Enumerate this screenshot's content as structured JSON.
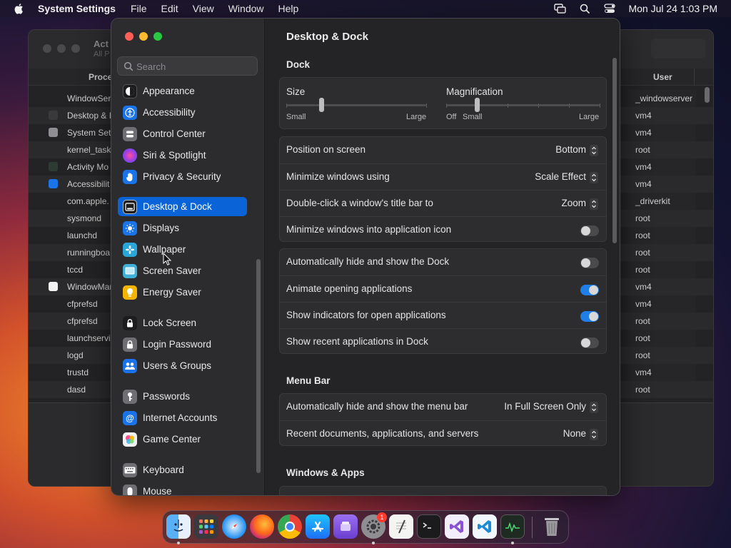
{
  "menubar": {
    "app_name": "System Settings",
    "items": [
      "File",
      "Edit",
      "View",
      "Window",
      "Help"
    ],
    "clock": "Mon Jul 24  1:03 PM"
  },
  "activity_monitor": {
    "title": "Act",
    "subtitle": "All P",
    "col_process": "Proce",
    "col_user": "User",
    "rows": [
      {
        "name": "WindowSer",
        "user": "_windowserver"
      },
      {
        "name": "Desktop & I",
        "user": "vm4"
      },
      {
        "name": "System Set",
        "user": "vm4"
      },
      {
        "name": "kernel_task",
        "user": "root"
      },
      {
        "name": "Activity Mo",
        "user": "vm4"
      },
      {
        "name": "Accessibilit",
        "user": "vm4"
      },
      {
        "name": "com.apple.",
        "user": "_driverkit"
      },
      {
        "name": "sysmond",
        "user": "root"
      },
      {
        "name": "launchd",
        "user": "root"
      },
      {
        "name": "runningboa",
        "user": "root"
      },
      {
        "name": "tccd",
        "user": "root"
      },
      {
        "name": "WindowMar",
        "user": "vm4"
      },
      {
        "name": "cfprefsd",
        "user": "vm4"
      },
      {
        "name": "cfprefsd",
        "user": "root"
      },
      {
        "name": "launchservi",
        "user": "root"
      },
      {
        "name": "logd",
        "user": "root"
      },
      {
        "name": "trustd",
        "user": "vm4"
      },
      {
        "name": "dasd",
        "user": "root"
      }
    ]
  },
  "settings": {
    "search_placeholder": "Search",
    "sidebar": [
      {
        "label": "Appearance",
        "icon": "appearance-icon",
        "color": "#1c1c1e"
      },
      {
        "label": "Accessibility",
        "icon": "accessibility-icon",
        "color": "#1a73e8"
      },
      {
        "label": "Control Center",
        "icon": "control-center-icon",
        "color": "#6e6e73"
      },
      {
        "label": "Siri & Spotlight",
        "icon": "siri-icon",
        "color": "#b03ad6"
      },
      {
        "label": "Privacy & Security",
        "icon": "privacy-hand-icon",
        "color": "#1a73e8"
      },
      {
        "label": "Desktop & Dock",
        "icon": "desktop-dock-icon",
        "color": "#1c1c1e"
      },
      {
        "label": "Displays",
        "icon": "displays-icon",
        "color": "#1a73e8"
      },
      {
        "label": "Wallpaper",
        "icon": "wallpaper-icon",
        "color": "#2aa7d6"
      },
      {
        "label": "Screen Saver",
        "icon": "screen-saver-icon",
        "color": "#3fb0d8"
      },
      {
        "label": "Energy Saver",
        "icon": "energy-saver-icon",
        "color": "#f5b400"
      },
      {
        "label": "Lock Screen",
        "icon": "lock-screen-icon",
        "color": "#1c1c1e"
      },
      {
        "label": "Login Password",
        "icon": "login-password-icon",
        "color": "#6e6e73"
      },
      {
        "label": "Users & Groups",
        "icon": "users-groups-icon",
        "color": "#1a73e8"
      },
      {
        "label": "Passwords",
        "icon": "passwords-key-icon",
        "color": "#6e6e73"
      },
      {
        "label": "Internet Accounts",
        "icon": "internet-accounts-icon",
        "color": "#1a73e8"
      },
      {
        "label": "Game Center",
        "icon": "game-center-icon",
        "color": "#e8e8e8"
      },
      {
        "label": "Keyboard",
        "icon": "keyboard-icon",
        "color": "#6e6e73"
      },
      {
        "label": "Mouse",
        "icon": "mouse-icon",
        "color": "#6e6e73"
      }
    ],
    "selected": "Desktop & Dock",
    "content": {
      "title": "Desktop & Dock",
      "dock_heading": "Dock",
      "size_label": "Size",
      "size_small": "Small",
      "size_large": "Large",
      "size_value": 0.25,
      "mag_label": "Magnification",
      "mag_off": "Off",
      "mag_small": "Small",
      "mag_large": "Large",
      "mag_value": 0.2,
      "position_label": "Position on screen",
      "position_value": "Bottom",
      "minimize_label": "Minimize windows using",
      "minimize_value": "Scale Effect",
      "doubleclick_label": "Double-click a window's title bar to",
      "doubleclick_value": "Zoom",
      "minimize_icon_label": "Minimize windows into application icon",
      "autohide_label": "Automatically hide and show the Dock",
      "animate_label": "Animate opening applications",
      "indicators_label": "Show indicators for open applications",
      "recent_label": "Show recent applications in Dock",
      "menubar_heading": "Menu Bar",
      "menubar_autohide_label": "Automatically hide and show the menu bar",
      "menubar_autohide_value": "In Full Screen Only",
      "recent_docs_label": "Recent documents, applications, and servers",
      "recent_docs_value": "None",
      "windows_heading": "Windows & Apps",
      "toggles": {
        "minimize_icon": false,
        "autohide": false,
        "animate": true,
        "indicators": true,
        "recent": false
      }
    }
  },
  "dock": {
    "items": [
      "finder-icon",
      "launchpad-icon",
      "safari-icon",
      "firefox-icon",
      "chrome-icon",
      "app-store-icon",
      "purple-app-icon",
      "system-settings-icon",
      "textedit-icon",
      "terminal-icon",
      "visual-studio-icon",
      "vscode-icon",
      "activity-monitor-icon",
      "trash-icon"
    ],
    "settings_badge": "1"
  },
  "colors": {
    "accent": "#0a64d8",
    "toggle_on": "#1f7fe6",
    "close": "#ff5f57",
    "minimize": "#febc2e",
    "maximize": "#28c840"
  }
}
